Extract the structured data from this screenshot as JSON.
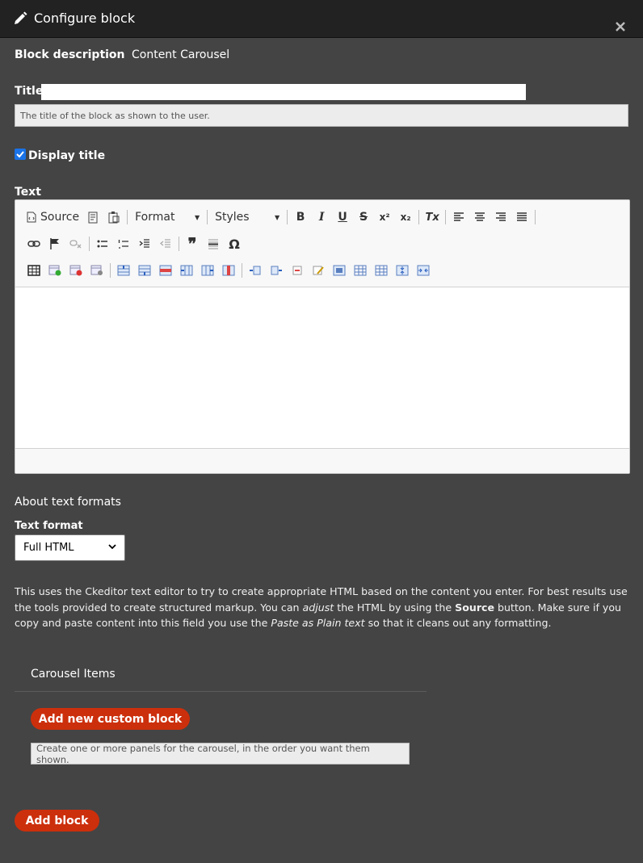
{
  "dialog": {
    "title": "Configure block",
    "close_icon": "close-icon",
    "edit_icon": "pencil-icon"
  },
  "block_description": {
    "label": "Block description",
    "value": "Content Carousel"
  },
  "title_field": {
    "label": "Title",
    "value": "",
    "help": "The title of the block as shown to the user."
  },
  "display_title": {
    "label": "Display title",
    "checked": true
  },
  "text_field": {
    "label": "Text",
    "toolbar": {
      "source_label": "Source",
      "format_label": "Format",
      "styles_label": "Styles",
      "bold": "B",
      "italic": "I",
      "underline": "U",
      "strike": "S",
      "superscript": "x²",
      "subscript": "x₂",
      "remove_format": "Tx",
      "blockquote": "❞",
      "special_char": "Ω"
    },
    "content": ""
  },
  "about_text_formats": "About text formats",
  "text_format": {
    "label": "Text format",
    "selected": "Full HTML"
  },
  "info": {
    "part1": "This uses the Ckeditor text editor to try to create appropriate HTML based on the content you enter. For best results use the tools provided to create structured markup. You can ",
    "em1": "adjust",
    "part2": " the HTML by using the ",
    "strong1": "Source",
    "part3": " button. Make sure if you copy and paste content into this field you use the ",
    "em2": "Paste as Plain text",
    "part4": " so that it cleans out any formatting."
  },
  "carousel": {
    "title": "Carousel Items",
    "add_button": "Add new custom block",
    "help": "Create one or more panels for the carousel, in the order you want them shown."
  },
  "submit": {
    "label": "Add block"
  },
  "colors": {
    "background": "#444444",
    "titlebar": "#222222",
    "accent_button": "#cc2f0c",
    "checkbox": "#1a73e8"
  }
}
